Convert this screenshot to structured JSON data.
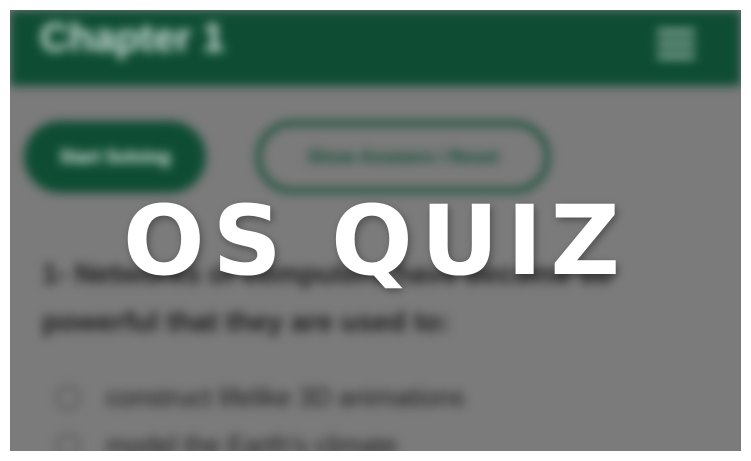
{
  "header": {
    "title": "Chapter 1"
  },
  "buttons": {
    "start": "Start Solving",
    "show": "Show Answers / Reset"
  },
  "question": {
    "text": "1- Networks of computers have become so powerful that they are used to:"
  },
  "options": [
    "construct lifelike 3D animations",
    "model the Earth's climate"
  ],
  "overlay": {
    "title": "OS QUIZ"
  },
  "colors": {
    "primary": "#0e4d34",
    "dim": "#7b7b7b"
  }
}
